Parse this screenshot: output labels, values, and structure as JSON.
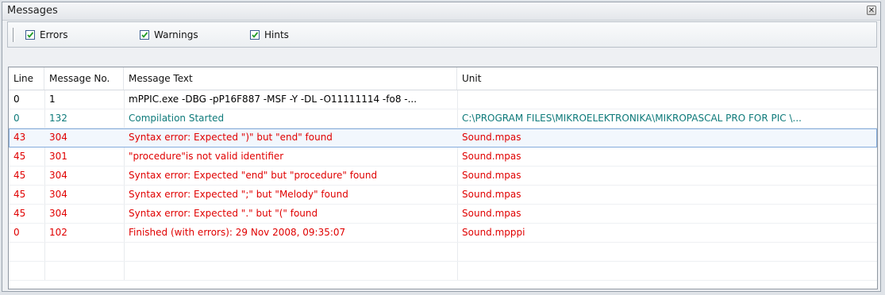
{
  "panel": {
    "title": "Messages"
  },
  "filters": [
    {
      "label": "Errors",
      "checked": true
    },
    {
      "label": "Warnings",
      "checked": true
    },
    {
      "label": "Hints",
      "checked": true
    }
  ],
  "columns": [
    "Line",
    "Message No.",
    "Message Text",
    "Unit"
  ],
  "colors": {
    "normal": "#000000",
    "info": "#0e7a7a",
    "error": "#e00000"
  },
  "rows": [
    {
      "line": "0",
      "msgno": "1",
      "text": "mPPIC.exe -DBG -pP16F887 -MSF -Y -DL -O11111114 -fo8 -...",
      "unit": "",
      "kind": "normal"
    },
    {
      "line": "0",
      "msgno": "132",
      "text": "Compilation Started",
      "unit": "C:\\PROGRAM FILES\\MIKROELEKTRONIKA\\MIKROPASCAL PRO FOR PIC \\...",
      "kind": "info"
    },
    {
      "line": "43",
      "msgno": "304",
      "text": "Syntax error: Expected \")\" but \"end\" found",
      "unit": "Sound.mpas",
      "kind": "error",
      "selected": true
    },
    {
      "line": "45",
      "msgno": "301",
      "text": "\"procedure\"is not valid identifier",
      "unit": "Sound.mpas",
      "kind": "error"
    },
    {
      "line": "45",
      "msgno": "304",
      "text": "Syntax error: Expected \"end\" but \"procedure\" found",
      "unit": "Sound.mpas",
      "kind": "error"
    },
    {
      "line": "45",
      "msgno": "304",
      "text": "Syntax error: Expected \";\" but \"Melody\" found",
      "unit": "Sound.mpas",
      "kind": "error"
    },
    {
      "line": "45",
      "msgno": "304",
      "text": "Syntax error: Expected \".\" but \"(\" found",
      "unit": "Sound.mpas",
      "kind": "error"
    },
    {
      "line": "0",
      "msgno": "102",
      "text": "Finished (with errors): 29 Nov 2008, 09:35:07",
      "unit": "Sound.mpppi",
      "kind": "error"
    }
  ]
}
